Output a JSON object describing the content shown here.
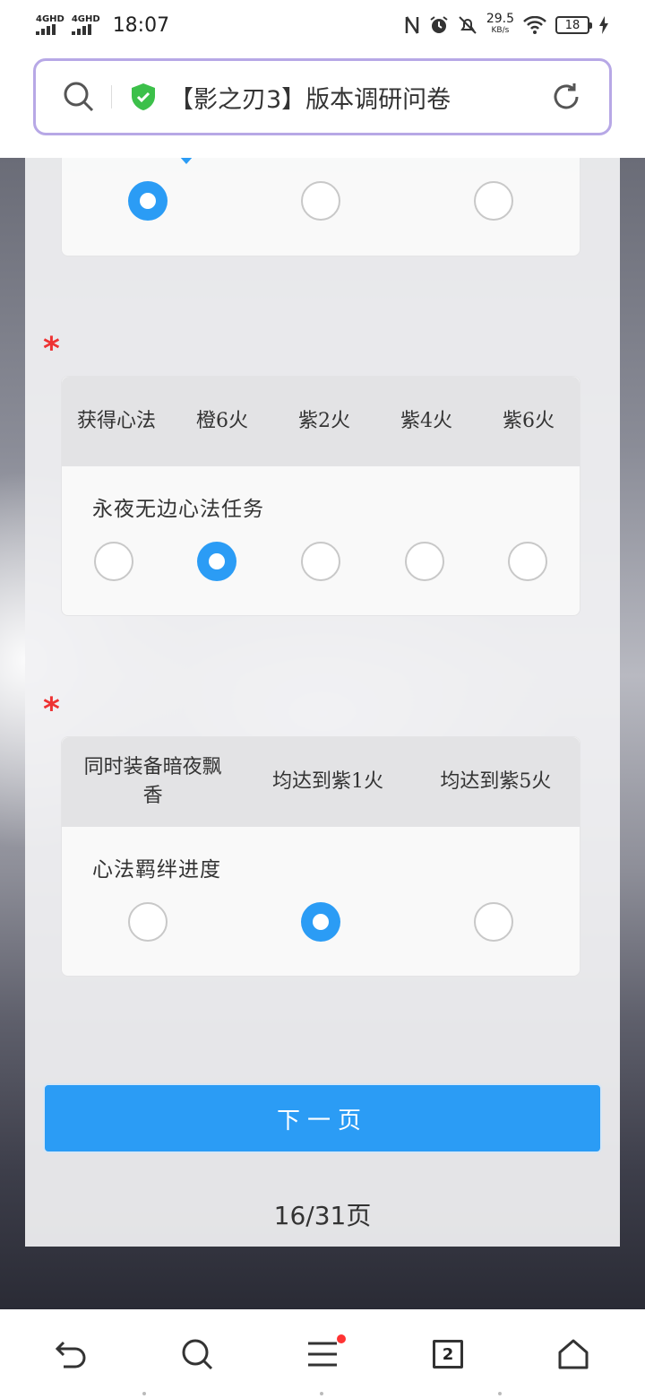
{
  "status_bar": {
    "network_1": "4GHD",
    "network_2": "4GHD",
    "time": "18:07",
    "speed_value": "29.5",
    "speed_unit": "KB/s",
    "battery": "18"
  },
  "address_bar": {
    "title": "【影之刃3】版本调研问卷"
  },
  "questions": [
    {
      "columns": [
        "",
        "",
        ""
      ],
      "selected_index": 0
    },
    {
      "required_mark": "*",
      "columns": [
        "获得心法",
        "橙6火",
        "紫2火",
        "紫4火",
        "紫6火"
      ],
      "row_label": "永夜无边心法任务",
      "selected_index": 1
    },
    {
      "required_mark": "*",
      "columns": [
        "同时装备暗夜飘香",
        "均达到紫1火",
        "均达到紫5火"
      ],
      "row_label": "心法羁绊进度",
      "selected_index": 1
    }
  ],
  "next_button": "下一页",
  "pager": "16/31页",
  "bottom_nav": {
    "tab_count": "2",
    "icons": [
      "back-icon",
      "search-icon",
      "menu-icon",
      "tabs-icon",
      "home-icon"
    ]
  },
  "colors": {
    "accent": "#2b9cf5",
    "required": "#e33333",
    "address_border": "#b7a8e6"
  }
}
